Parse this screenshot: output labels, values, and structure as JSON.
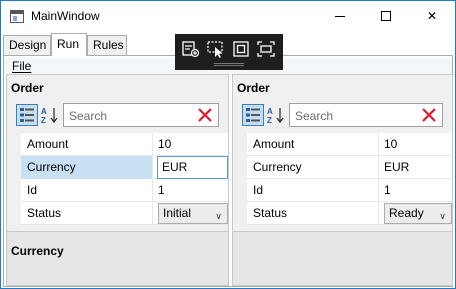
{
  "window": {
    "title": "MainWindow"
  },
  "titlebar_buttons": {
    "minimize": "minimize",
    "maximize": "maximize",
    "close": "✕"
  },
  "tabs": [
    {
      "label": "Design"
    },
    {
      "label": "Run"
    },
    {
      "label": "Rules"
    }
  ],
  "menu": {
    "file": "File"
  },
  "devtools": {
    "buttons": [
      "live-visual-tree-icon",
      "select-element-icon",
      "display-layout-adorners-icon",
      "track-focus-icon"
    ]
  },
  "left_panel": {
    "title": "Order",
    "search_placeholder": "Search",
    "rows": [
      {
        "name": "Amount",
        "value": "10"
      },
      {
        "name": "Currency",
        "value": "EUR"
      },
      {
        "name": "Id",
        "value": "1"
      },
      {
        "name": "Status",
        "value": "Initial"
      }
    ],
    "description_title": "Currency"
  },
  "right_panel": {
    "title": "Order",
    "search_placeholder": "Search",
    "rows": [
      {
        "name": "Amount",
        "value": "10"
      },
      {
        "name": "Currency",
        "value": "EUR"
      },
      {
        "name": "Id",
        "value": "1"
      },
      {
        "name": "Status",
        "value": "Ready"
      }
    ]
  },
  "colors": {
    "accent": "#1f7ac9",
    "selection": "#c7e0f4",
    "clear_icon": "#e81123"
  }
}
